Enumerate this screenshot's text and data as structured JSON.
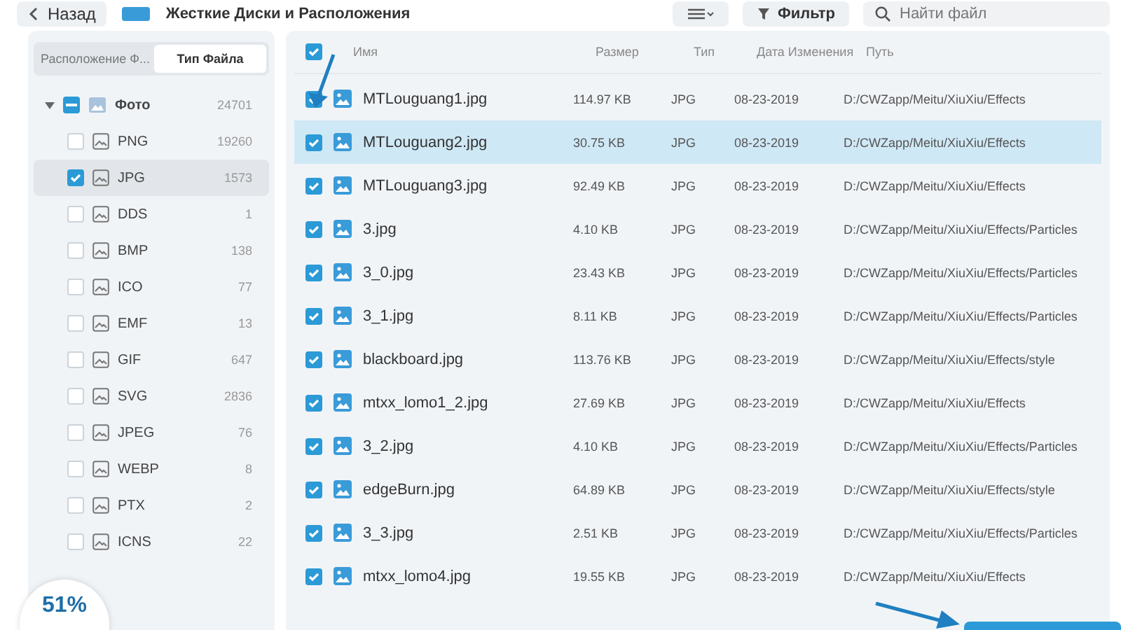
{
  "top_bar": {
    "back_button": "Назад",
    "location_title": "Жесткие Диски и Расположения",
    "filter_button": "Фильтр",
    "search": {
      "placeholder": "Найти файл"
    }
  },
  "sidebar": {
    "tabs": [
      {
        "label": "Расположение Ф...",
        "selected": false
      },
      {
        "label": "Тип Файла",
        "selected": true
      }
    ],
    "tree": [
      {
        "label": "Фото",
        "count": "24701",
        "expanded": true,
        "indeterminate": true,
        "children": [
          {
            "label": "PNG",
            "count": "19260",
            "checked": false,
            "selected": false
          },
          {
            "label": "JPG",
            "count": "1573",
            "checked": true,
            "selected": true
          },
          {
            "label": "DDS",
            "count": "1",
            "checked": false,
            "selected": false
          },
          {
            "label": "BMP",
            "count": "138",
            "checked": false,
            "selected": false
          },
          {
            "label": "ICO",
            "count": "77",
            "checked": false,
            "selected": false
          },
          {
            "label": "EMF",
            "count": "13",
            "checked": false,
            "selected": false
          },
          {
            "label": "GIF",
            "count": "647",
            "checked": false,
            "selected": false
          },
          {
            "label": "SVG",
            "count": "2836",
            "checked": false,
            "selected": false
          },
          {
            "label": "JPEG",
            "count": "76",
            "checked": false,
            "selected": false
          },
          {
            "label": "WEBP",
            "count": "8",
            "checked": false,
            "selected": false
          },
          {
            "label": "PTX",
            "count": "2",
            "checked": false,
            "selected": false
          },
          {
            "label": "ICNS",
            "count": "22",
            "checked": false,
            "selected": false
          }
        ]
      }
    ]
  },
  "table": {
    "select_all_checked": true,
    "columns": [
      "Имя",
      "Размер",
      "Тип",
      "Дата Изменения",
      "Путь"
    ],
    "rows": [
      {
        "name": "MTLouguang1.jpg",
        "size": "114.97 KB",
        "type": "JPG",
        "date": "08-23-2019",
        "path": "D:/CWZapp/Meitu/XiuXiu/Effects",
        "checked": true,
        "selected": false
      },
      {
        "name": "MTLouguang2.jpg",
        "size": "30.75 KB",
        "type": "JPG",
        "date": "08-23-2019",
        "path": "D:/CWZapp/Meitu/XiuXiu/Effects",
        "checked": true,
        "selected": true
      },
      {
        "name": "MTLouguang3.jpg",
        "size": "92.49 KB",
        "type": "JPG",
        "date": "08-23-2019",
        "path": "D:/CWZapp/Meitu/XiuXiu/Effects",
        "checked": true,
        "selected": false
      },
      {
        "name": "3.jpg",
        "size": "4.10 KB",
        "type": "JPG",
        "date": "08-23-2019",
        "path": "D:/CWZapp/Meitu/XiuXiu/Effects/Particles",
        "checked": true,
        "selected": false
      },
      {
        "name": "3_0.jpg",
        "size": "23.43 KB",
        "type": "JPG",
        "date": "08-23-2019",
        "path": "D:/CWZapp/Meitu/XiuXiu/Effects/Particles",
        "checked": true,
        "selected": false
      },
      {
        "name": "3_1.jpg",
        "size": "8.11 KB",
        "type": "JPG",
        "date": "08-23-2019",
        "path": "D:/CWZapp/Meitu/XiuXiu/Effects/Particles",
        "checked": true,
        "selected": false
      },
      {
        "name": "blackboard.jpg",
        "size": "113.76 KB",
        "type": "JPG",
        "date": "08-23-2019",
        "path": "D:/CWZapp/Meitu/XiuXiu/Effects/style",
        "checked": true,
        "selected": false
      },
      {
        "name": "mtxx_lomo1_2.jpg",
        "size": "27.69 KB",
        "type": "JPG",
        "date": "08-23-2019",
        "path": "D:/CWZapp/Meitu/XiuXiu/Effects",
        "checked": true,
        "selected": false
      },
      {
        "name": "3_2.jpg",
        "size": "4.10 KB",
        "type": "JPG",
        "date": "08-23-2019",
        "path": "D:/CWZapp/Meitu/XiuXiu/Effects/Particles",
        "checked": true,
        "selected": false
      },
      {
        "name": "edgeBurn.jpg",
        "size": "64.89 KB",
        "type": "JPG",
        "date": "08-23-2019",
        "path": "D:/CWZapp/Meitu/XiuXiu/Effects/style",
        "checked": true,
        "selected": false
      },
      {
        "name": "3_3.jpg",
        "size": "2.51 KB",
        "type": "JPG",
        "date": "08-23-2019",
        "path": "D:/CWZapp/Meitu/XiuXiu/Effects/Particles",
        "checked": true,
        "selected": false
      },
      {
        "name": "mtxx_lomo4.jpg",
        "size": "19.55 KB",
        "type": "JPG",
        "date": "08-23-2019",
        "path": "D:/CWZapp/Meitu/XiuXiu/Effects",
        "checked": true,
        "selected": false
      }
    ]
  },
  "progress": {
    "label": "51%"
  }
}
